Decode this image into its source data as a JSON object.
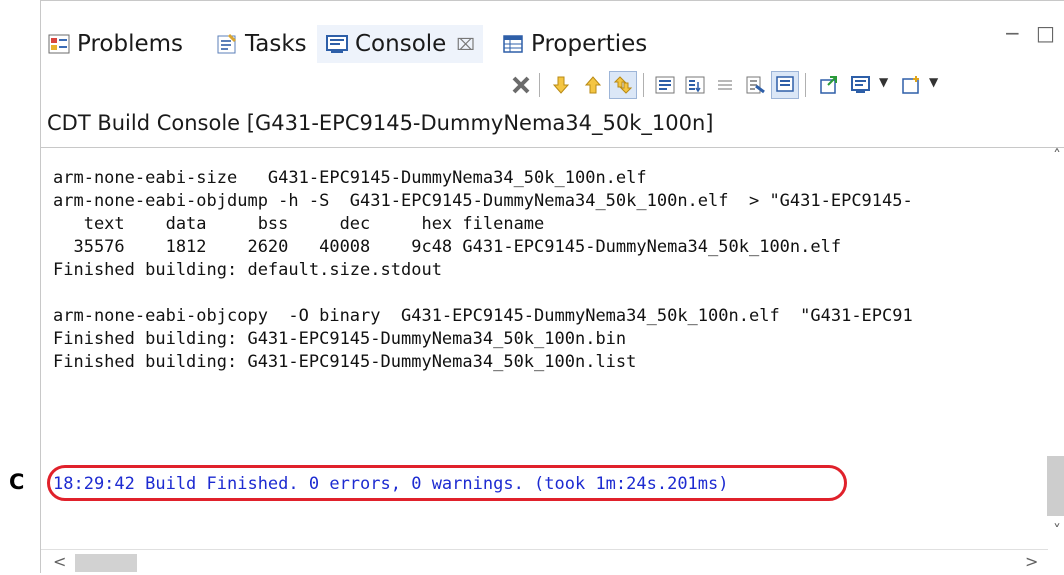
{
  "tabs": [
    {
      "label": "Problems",
      "icon": "problems-icon"
    },
    {
      "label": "Tasks",
      "icon": "tasks-icon"
    },
    {
      "label": "Console",
      "icon": "console-icon",
      "active": true,
      "close": "⌧"
    },
    {
      "label": "Properties",
      "icon": "properties-icon"
    }
  ],
  "window_controls": {
    "minimize": "−",
    "maximize": "□"
  },
  "toolbar_icons": [
    "remove-icon",
    "scroll-down-icon",
    "scroll-up-icon",
    "scroll-lock-icon",
    "word-wrap-icon",
    "show-console-icon",
    "clear-icon",
    "pin-icon",
    "display-selected-icon",
    "open-console-icon",
    "new-console-icon"
  ],
  "console_title": "CDT Build Console [G431-EPC9145-DummyNema34_50k_100n]",
  "console_lines": [
    "arm-none-eabi-size   G431-EPC9145-DummyNema34_50k_100n.elf",
    "arm-none-eabi-objdump -h -S  G431-EPC9145-DummyNema34_50k_100n.elf  > \"G431-EPC9145-",
    "   text    data     bss     dec     hex filename",
    "  35576    1812    2620   40008    9c48 G431-EPC9145-DummyNema34_50k_100n.elf",
    "Finished building: default.size.stdout",
    "",
    "arm-none-eabi-objcopy  -O binary  G431-EPC9145-DummyNema34_50k_100n.elf  \"G431-EPC91",
    "Finished building: G431-EPC9145-DummyNema34_50k_100n.bin",
    "Finished building: G431-EPC9145-DummyNema34_50k_100n.list"
  ],
  "build_finished": "18:29:42 Build Finished. 0 errors, 0 warnings. (took 1m:24s.201ms)",
  "callout_label": "C",
  "scroll": {
    "up": "˄",
    "down": "˅",
    "left": "<",
    "right": ">"
  },
  "colors": {
    "build_finished_text": "#1d2bd1",
    "callout": "#e0212b",
    "active_tab": "#eef3fb"
  }
}
